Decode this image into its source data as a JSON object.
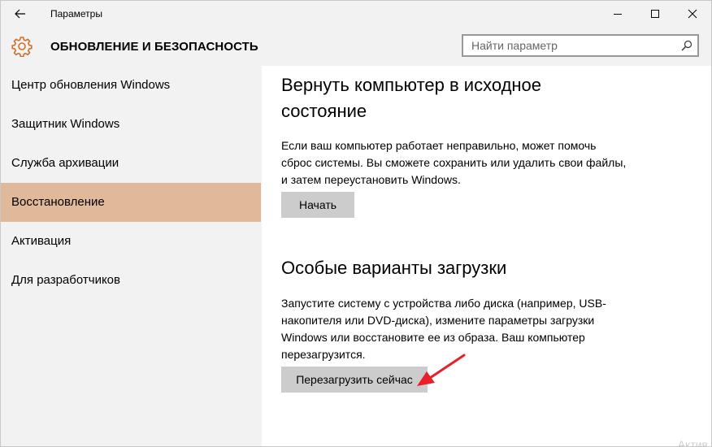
{
  "window": {
    "title": "Параметры",
    "controls": [
      "minimize",
      "maximize",
      "close"
    ]
  },
  "header": {
    "section_title": "ОБНОВЛЕНИЕ И БЕЗОПАСНОСТЬ",
    "search_placeholder": "Найти параметр"
  },
  "sidebar": {
    "items": [
      {
        "label": "Центр обновления Windows"
      },
      {
        "label": "Защитник Windows"
      },
      {
        "label": "Служба архивации"
      },
      {
        "label": "Восстановление",
        "active": true
      },
      {
        "label": "Активация"
      },
      {
        "label": "Для разработчиков"
      }
    ]
  },
  "content": {
    "reset": {
      "heading_line1": "Вернуть компьютер в исходное",
      "heading_line2": "состояние",
      "text_line1": "Если ваш компьютер работает неправильно, может помочь",
      "text_line2": "сброс системы. Вы сможете сохранить или удалить свои файлы,",
      "text_line3": "и затем переустановить Windows.",
      "button_label": "Начать"
    },
    "advanced": {
      "heading": "Особые варианты загрузки",
      "text_line1": "Запустите систему с устройства либо диска (например, USB-",
      "text_line2": "накопителя или DVD-диска), измените параметры загрузки",
      "text_line3": "Windows или восстановите ее из образа. Ваш компьютер",
      "text_line4": "перезагрузится.",
      "button_label": "Перезагрузить сейчас"
    },
    "watermark": "Актив"
  },
  "colors": {
    "active_item": "#e0b89a",
    "button_bg": "#cccccc",
    "sidebar_bg": "#f2f2f2",
    "arrow": "#e8202a"
  }
}
